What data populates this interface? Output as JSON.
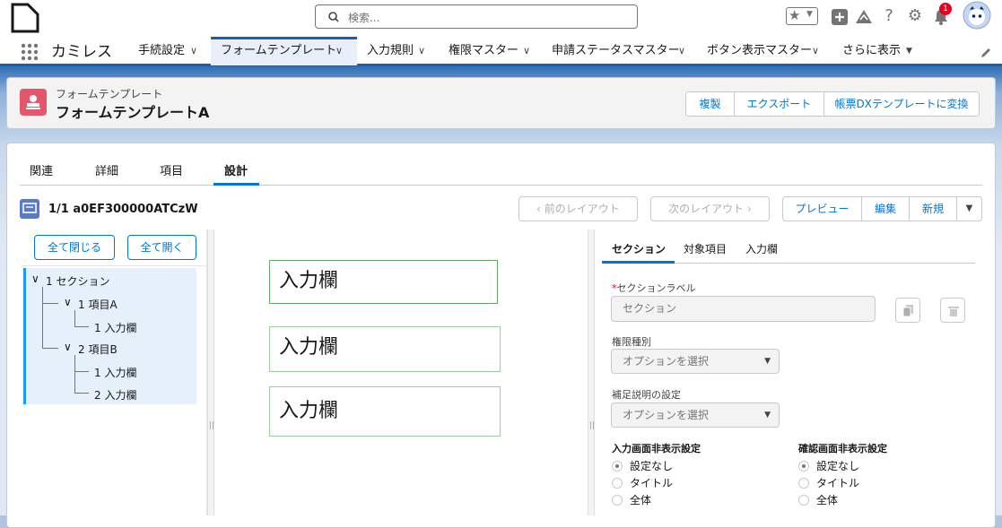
{
  "global": {
    "search_placeholder": "検索...",
    "notification_count": "1"
  },
  "nav": {
    "app_name": "カミレス",
    "items": [
      {
        "label": "手続設定"
      },
      {
        "label": "フォームテンプレート"
      },
      {
        "label": "入力規則"
      },
      {
        "label": "権限マスター"
      },
      {
        "label": "申請ステータスマスター"
      },
      {
        "label": "ボタン表示マスター"
      },
      {
        "label": "さらに表示"
      }
    ]
  },
  "header": {
    "object_label": "フォームテンプレート",
    "record_name": "フォームテンプレートA",
    "actions": [
      "複製",
      "エクスポート",
      "帳票DXテンプレートに変換"
    ]
  },
  "tabs": [
    "関連",
    "詳細",
    "項目",
    "設計"
  ],
  "active_tab": "設計",
  "designer": {
    "record_info": "1/1 a0EF300000ATCzW",
    "prev_layout": "前のレイアウト",
    "next_layout": "次のレイアウト",
    "preview": "プレビュー",
    "edit": "編集",
    "new": "新規",
    "collapse_all": "全て閉じる",
    "expand_all": "全て開く",
    "tree": [
      {
        "label": "1 セクション"
      },
      {
        "label": "1 項目A"
      },
      {
        "label": "1 入力欄"
      },
      {
        "label": "2 項目B"
      },
      {
        "label": "1 入力欄"
      },
      {
        "label": "2 入力欄"
      }
    ],
    "canvas_fields": [
      "入力欄",
      "入力欄",
      "入力欄"
    ]
  },
  "props": {
    "tabs": [
      "セクション",
      "対象項目",
      "入力欄"
    ],
    "section_label_title": "セクションラベル",
    "section_label_value": "セクション",
    "permission_label": "権限種別",
    "permission_value": "オプションを選択",
    "supplement_label": "補足説明の設定",
    "supplement_value": "オプションを選択",
    "input_hide_label": "入力画面非表示設定",
    "confirm_hide_label": "確認画面非表示設定",
    "input_hide_options": [
      "設定なし",
      "タイトル",
      "全体"
    ],
    "confirm_hide_options": [
      "設定なし",
      "タイトル",
      "全体"
    ]
  },
  "colors": {
    "accent": "#0176d3",
    "nav_active_bg": "#e8eff8",
    "header_icon_bg": "#e3566b",
    "tree_selected_bg": "#e5f0fb",
    "zoom_bar": "#6aa7e8",
    "canvas_border": "#66a86a"
  }
}
